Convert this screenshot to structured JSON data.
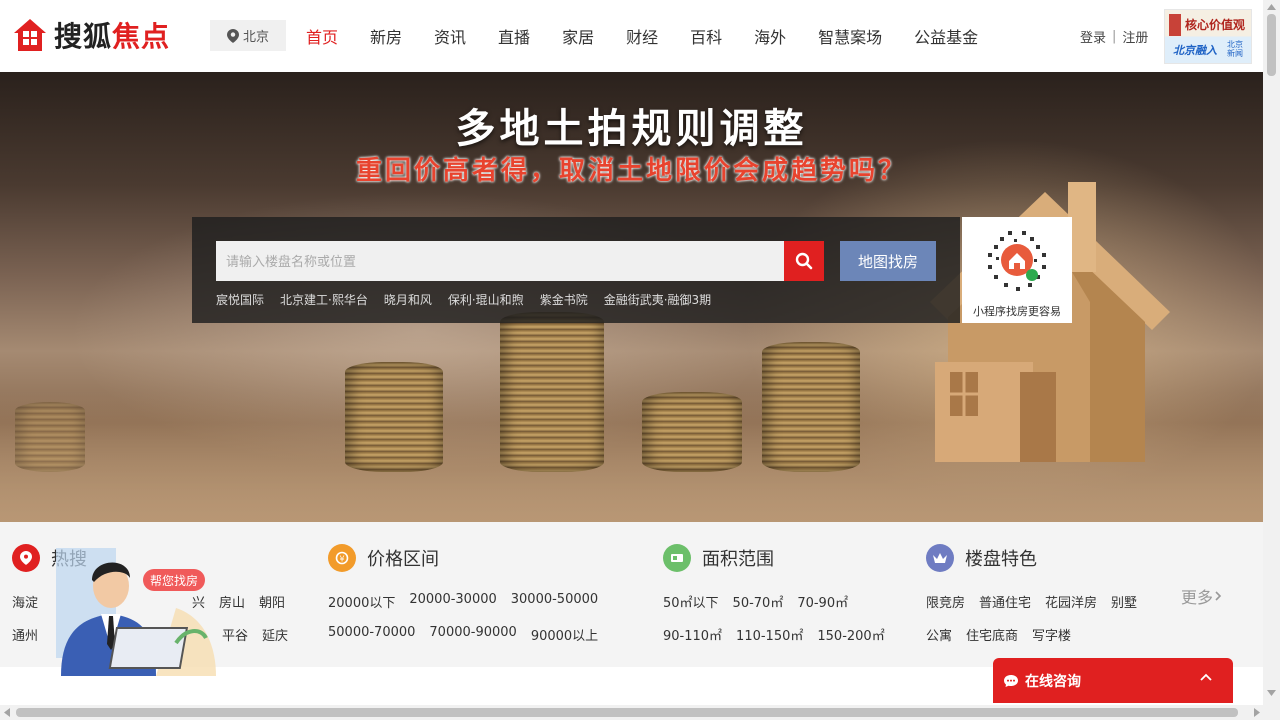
{
  "header": {
    "logo": {
      "text_a": "搜狐",
      "text_b": "焦点"
    },
    "city": "北京",
    "nav": [
      {
        "label": "首页",
        "active": true
      },
      {
        "label": "新房"
      },
      {
        "label": "资讯"
      },
      {
        "label": "直播"
      },
      {
        "label": "家居"
      },
      {
        "label": "财经"
      },
      {
        "label": "百科"
      },
      {
        "label": "海外"
      },
      {
        "label": "智慧案场"
      },
      {
        "label": "公益基金"
      }
    ],
    "auth": {
      "login": "登录",
      "sep": "|",
      "register": "注册"
    },
    "ad": {
      "line1": "核心价值观",
      "line2": "北京融入",
      "line3": "北京新闻"
    }
  },
  "hero": {
    "title": "多地土拍规则调整",
    "subtitle": "重回价高者得，取消土地限价会成趋势吗？",
    "search": {
      "placeholder": "请输入楼盘名称或位置",
      "map_button": "地图找房",
      "hot_links": [
        "宸悦国际",
        "北京建工·熙华台",
        "晓月和风",
        "保利·琨山和煦",
        "紫金书院",
        "金融街武夷·融御3期"
      ]
    },
    "qr_caption": "小程序找房更容易"
  },
  "filters": {
    "hot": {
      "title": "热搜",
      "row1": [
        "海淀",
        "兴",
        "房山",
        "朝阳"
      ],
      "row2": [
        "通州",
        "平谷",
        "延庆"
      ]
    },
    "price": {
      "title": "价格区间",
      "row1": [
        "20000以下",
        "20000-30000",
        "30000-50000"
      ],
      "row2": [
        "50000-70000",
        "70000-90000",
        "90000以上"
      ]
    },
    "area": {
      "title": "面积范围",
      "row1": [
        "50㎡以下",
        "50-70㎡",
        "70-90㎡"
      ],
      "row2": [
        "90-110㎡",
        "110-150㎡",
        "150-200㎡"
      ]
    },
    "feature": {
      "title": "楼盘特色",
      "row1": [
        "限竞房",
        "普通住宅",
        "花园洋房",
        "别墅"
      ],
      "row2": [
        "公寓",
        "住宅底商",
        "写字楼"
      ]
    },
    "more": "更多"
  },
  "widgets": {
    "help": "帮您找房",
    "consult": "在线咨询"
  },
  "colors": {
    "brand": "#e02020",
    "map_button": "#6c86b8"
  }
}
